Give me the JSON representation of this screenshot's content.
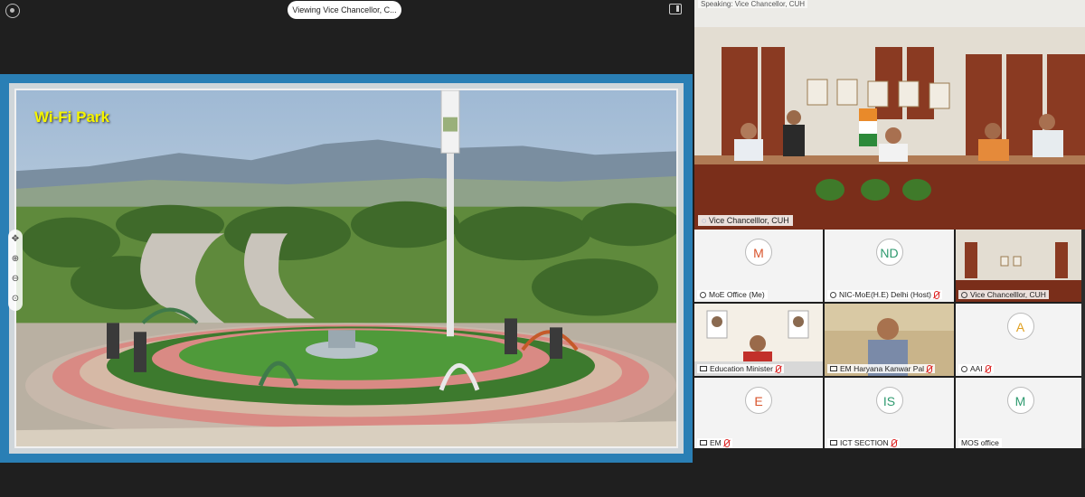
{
  "header": {
    "viewing_text": "Viewing Vice Chancellor, C..."
  },
  "slide": {
    "title": "Wi-Fi Park"
  },
  "speaker": {
    "speaking_label": "Speaking: Vice Chancellor, CUH",
    "name": "Vice Chancelllor, CUH"
  },
  "tiles": [
    {
      "initials": "M",
      "name": "MoE Office (Me)",
      "mic": "on"
    },
    {
      "initials": "ND",
      "name": "NIC-MoE(H.E) Delhi (Host)",
      "mic": "off"
    },
    {
      "initials": "",
      "name": "Vice Chancelllor, CUH",
      "mic": "none"
    },
    {
      "initials": "",
      "name": "Education Minister",
      "mic": "off"
    },
    {
      "initials": "",
      "name": "EM Haryana Kanwar Pal",
      "mic": "off"
    },
    {
      "initials": "A",
      "name": "AAI",
      "mic": "off"
    },
    {
      "initials": "E",
      "name": "EM",
      "mic": "off"
    },
    {
      "initials": "IS",
      "name": "ICT SECTION",
      "mic": "off"
    },
    {
      "initials": "M",
      "name": "MOS office",
      "mic": "none"
    }
  ],
  "colors": {
    "accent": "#2a7fb5",
    "slide_title": "#f4f400",
    "active_tile": "#3aa0e8"
  }
}
